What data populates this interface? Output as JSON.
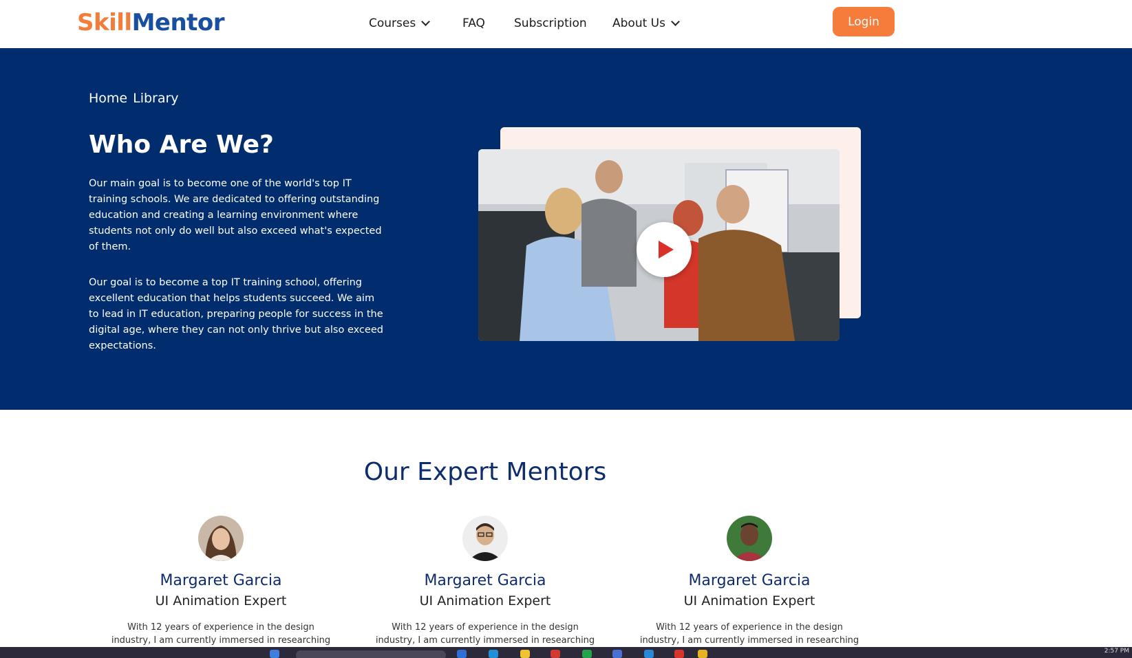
{
  "brand": {
    "part1": "Skill",
    "part2": "Mentor"
  },
  "nav": [
    {
      "label": "Courses",
      "dropdown": true
    },
    {
      "label": "FAQ",
      "dropdown": false
    },
    {
      "label": "Subscription",
      "dropdown": false
    },
    {
      "label": "About Us",
      "dropdown": true
    }
  ],
  "login_label": "Login",
  "hero": {
    "breadcrumbs": [
      "Home",
      "Library"
    ],
    "title": "Who Are We?",
    "paragraph1": " Our main goal is to become one of the world's top IT training schools. We are dedicated to offering outstanding education and creating a learning environment where students not only do well but also exceed what's expected of them.",
    "paragraph2": "Our goal is to become a top IT training school, offering excellent education that helps students succeed. We aim to lead in IT education, preparing people for success in the digital age, where they can not only thrive but also exceed expectations."
  },
  "mentors": {
    "title": "Our Expert Mentors",
    "items": [
      {
        "name": "Margaret Garcia",
        "role": "UI Animation Expert",
        "description": "With 12 years of experience in the design industry, I am currently immersed in researching VR design to"
      },
      {
        "name": "Margaret Garcia",
        "role": "UI Animation Expert",
        "description": "With 12 years of experience in the design industry, I am currently immersed in researching VR design to"
      },
      {
        "name": "Margaret Garcia",
        "role": "UI Animation Expert",
        "description": "With 12 years of experience in the design industry, I am currently immersed in researching VR design to"
      }
    ]
  },
  "colors": {
    "brand_orange": "#f67c3b",
    "brand_blue": "#1a4fa0",
    "hero_bg": "#012d6f",
    "heading_navy": "#0e2d6e"
  },
  "icons": {
    "nav_dropdown": "chevron-down-icon",
    "video": "play-icon"
  },
  "taskbar": {
    "time": "2:57 PM"
  }
}
